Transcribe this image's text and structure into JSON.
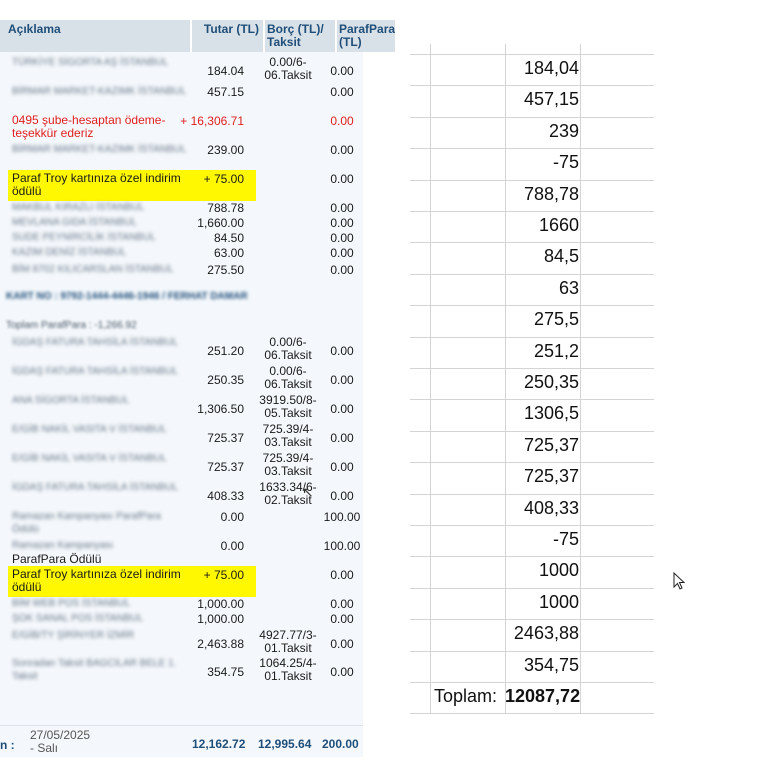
{
  "statement": {
    "header": {
      "description": "Açıklama",
      "amount": "Tutar (TL)",
      "debt": "Borç (TL)/ Taksit",
      "parafpara": "ParafPara (TL)"
    },
    "transactions": [
      {
        "desc": "TÜRKİYE SİGORTA AŞ İSTANBUL",
        "amount": "184.04",
        "inst": "0.00/6-06.Taksit",
        "pp": "0.00"
      },
      {
        "desc": "BİRMAR MARKET-KAZIMK İSTANBUL",
        "amount": "457.15",
        "inst": "",
        "pp": "0.00"
      },
      {
        "desc": "0495 şube-hesaptan ödeme-teşekkür ederiz",
        "amount": "+ 16,306.71",
        "inst": "",
        "pp": "0.00",
        "style": "red"
      },
      {
        "desc": "BİRMAR MARKET-KAZIMK İSTANBUL",
        "amount": "239.00",
        "inst": "",
        "pp": "0.00"
      },
      {
        "desc": "Paraf Troy kartınıza özel indirim ödülü",
        "amount": "+ 75.00",
        "inst": "",
        "pp": "0.00",
        "style": "highlight"
      },
      {
        "desc": "MAKBUL KIRAZLI İSTANBUL",
        "amount": "788.78",
        "inst": "",
        "pp": "0.00"
      },
      {
        "desc": "MEVLANA GIDA İSTANBUL",
        "amount": "1,660.00",
        "inst": "",
        "pp": "0.00"
      },
      {
        "desc": "SUDE PEYNİRCİLİK İSTANBUL",
        "amount": "84.50",
        "inst": "",
        "pp": "0.00"
      },
      {
        "desc": "KAZIM DENİZ İSTANBUL",
        "amount": "63.00",
        "inst": "",
        "pp": "0.00"
      },
      {
        "desc": "BİM 8702 KILICARSLAN İSTANBUL",
        "amount": "275.50",
        "inst": "",
        "pp": "0.00"
      },
      {
        "desc": "İGDAŞ FATURA TAHSİLA İSTANBUL",
        "amount": "251.20",
        "inst": "0.00/6-06.Taksit",
        "pp": "0.00"
      },
      {
        "desc": "İGDAŞ FATURA TAHSİLA İSTANBUL",
        "amount": "250.35",
        "inst": "0.00/6-06.Taksit",
        "pp": "0.00"
      },
      {
        "desc": "ANA SİGORTA İSTANBUL",
        "amount": "1,306.50",
        "inst": "3919.50/8-05.Taksit",
        "pp": "0.00"
      },
      {
        "desc": "E/GİB NAKİL VASITA V İSTANBUL",
        "amount": "725.37",
        "inst": "725.39/4-03.Taksit",
        "pp": "0.00"
      },
      {
        "desc": "E/GİB NAKİL VASITA V İSTANBUL",
        "amount": "725.37",
        "inst": "725.39/4-03.Taksit",
        "pp": "0.00"
      },
      {
        "desc": "İGDAŞ FATURA TAHSİLA İSTANBUL",
        "amount": "408.33",
        "inst": "1633.34/6-02.Taksit",
        "pp": "0.00"
      },
      {
        "desc": "Ramazan Kampanyası ParafPara Ödülü",
        "amount": "0.00",
        "inst": "",
        "pp": "100.00"
      },
      {
        "desc": "Ramazan Kampanyası",
        "amount": "0.00",
        "inst": "",
        "pp": "100.00"
      },
      {
        "desc": "ParafPara Ödülü",
        "amount": "",
        "inst": "",
        "pp": "",
        "style": "clear"
      },
      {
        "desc": "Paraf Troy kartınıza özel indirim ödülü",
        "amount": "+ 75.00",
        "inst": "",
        "pp": "0.00",
        "style": "highlight"
      },
      {
        "desc": "BİM WEB POS İSTANBUL",
        "amount": "1,000.00",
        "inst": "",
        "pp": "0.00"
      },
      {
        "desc": "ŞOK SANAL POS İSTANBUL",
        "amount": "1,000.00",
        "inst": "",
        "pp": "0.00"
      },
      {
        "desc": "E/GİB/TY ŞİRİNYER İZMİR",
        "amount": "2,463.88",
        "inst": "4927.77/3-01.Taksit",
        "pp": "0.00"
      },
      {
        "desc": "Sonradan Taksit BAGCILAR BELE 1. Taksit",
        "amount": "354.75",
        "inst": "1064.25/4-01.Taksit",
        "pp": "0.00"
      }
    ],
    "card_line": "KART NO : 9792-1444-4446-1946 / FERHAT DAMAR",
    "total_points": "Toplam ParafPara : -1,266.92",
    "footer": {
      "colon": "n   :",
      "date": "27/05/2025",
      "weekday": "- Salı",
      "amount_total": "12,162.72",
      "debt_total": "12,995.64",
      "parafpara_total": "200.00"
    }
  },
  "sheet": {
    "values": [
      "184,04",
      "457,15",
      "239",
      "-75",
      "788,78",
      "1660",
      "84,5",
      "63",
      "275,5",
      "251,2",
      "250,35",
      "1306,5",
      "725,37",
      "725,37",
      "408,33",
      "-75",
      "1000",
      "1000",
      "2463,88",
      "354,75"
    ],
    "total_label": "Toplam:",
    "total_value": "12087,72"
  }
}
